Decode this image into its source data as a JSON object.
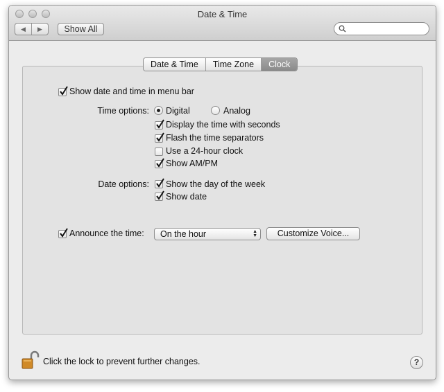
{
  "window": {
    "title": "Date & Time"
  },
  "toolbar": {
    "back_glyph": "◀",
    "forward_glyph": "▶",
    "show_all_label": "Show All",
    "search_placeholder": ""
  },
  "tabs": [
    {
      "label": "Date & Time",
      "active": false
    },
    {
      "label": "Time Zone",
      "active": false
    },
    {
      "label": "Clock",
      "active": true
    }
  ],
  "clock": {
    "show_in_menu_bar": {
      "label": "Show date and time in menu bar",
      "checked": true
    },
    "time_options": {
      "label": "Time options:",
      "mode": [
        {
          "label": "Digital",
          "selected": true
        },
        {
          "label": "Analog",
          "selected": false
        }
      ],
      "checkboxes": [
        {
          "label": "Display the time with seconds",
          "checked": true
        },
        {
          "label": "Flash the time separators",
          "checked": true
        },
        {
          "label": "Use a 24-hour clock",
          "checked": false
        },
        {
          "label": "Show AM/PM",
          "checked": true
        }
      ]
    },
    "date_options": {
      "label": "Date options:",
      "checkboxes": [
        {
          "label": "Show the day of the week",
          "checked": true
        },
        {
          "label": "Show date",
          "checked": true
        }
      ]
    },
    "announce": {
      "label": "Announce the time:",
      "checked": true,
      "interval_value": "On the hour",
      "customize_voice_label": "Customize Voice..."
    }
  },
  "footer": {
    "lock_text": "Click the lock to prevent further changes.",
    "help_label": "?"
  }
}
